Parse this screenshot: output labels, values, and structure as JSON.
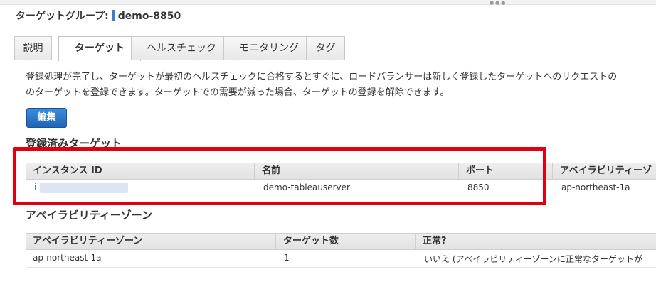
{
  "header": {
    "label": "ターゲットグループ:",
    "group_name": "demo-8850"
  },
  "tabs": [
    "説明",
    "ターゲット",
    "ヘルスチェック",
    "モニタリング",
    "タグ"
  ],
  "active_tab": "ターゲット",
  "description": {
    "line1": "登録処理が完了し、ターゲットが最初のヘルスチェックに合格するとすぐに、ロードバランサーは新しく登録したターゲットへのリクエストの",
    "line2": "のターゲットを登録できます。ターゲットでの需要が減った場合、ターゲットの登録を解除できます。"
  },
  "edit_button": "編集",
  "registered_targets": {
    "title": "登録済みターゲット",
    "columns": [
      "インスタンス ID",
      "名前",
      "ポート",
      "アベイラビリティーゾ"
    ],
    "rows": [
      {
        "instance_id": "i",
        "name": "demo-tableauserver",
        "port": "8850",
        "az": "ap-northeast-1a"
      }
    ]
  },
  "availability_zones": {
    "title": "アベイラビリティーゾーン",
    "columns": [
      "アベイラビリティーゾーン",
      "ターゲット数",
      "正常?"
    ],
    "rows": [
      {
        "zone": "ap-northeast-1a",
        "count": "1",
        "healthy": "いいえ (アベイラビリティーゾーンに正常なターゲットが"
      }
    ]
  },
  "colors": {
    "highlight": "#e0000f",
    "accent": "#3b80c4",
    "button": "#2a77c8"
  }
}
